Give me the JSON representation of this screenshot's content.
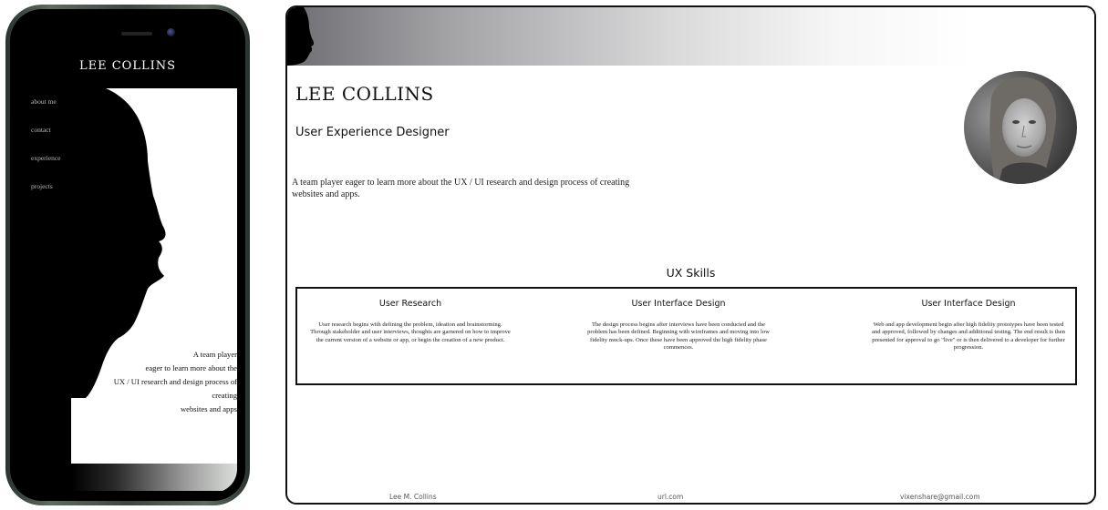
{
  "mobile": {
    "brand": "LEE COLLINS",
    "nav": [
      "about me",
      "contact",
      "experience",
      "projects"
    ],
    "tagline_lines": [
      "A team player",
      "eager to learn more about the",
      "UX / UI research and design process of",
      "creating",
      "websites and apps"
    ]
  },
  "desktop": {
    "name": "LEE COLLINS",
    "role": "User Experience Designer",
    "intro": "A team player eager to learn more about the UX / UI research and design process of creating websites and apps.",
    "skills_heading": "UX Skills",
    "skills": [
      {
        "title": "User Research",
        "body": "User research begins with defining the problem, ideation and brainstorming. Through stakeholder and user interviews, thoughts are garnered on how to improve the current version of a website or app, or begin the creation of a new product."
      },
      {
        "title": "User Interface Design",
        "body": "The design process begins after interviews have been conducted and the problem has been defined. Beginning with wireframes and moving into low fidelity mock-ups. Once these have been approved the high fidelity phase commences."
      },
      {
        "title": "User Interface Design",
        "body": "Web and app development begin after high fidelity prototypes have been tested and approved, followed by changes and additional testing. The end result is then presented for approval to go \"live\" or is then delivered to a developer for further progression."
      }
    ],
    "footer": {
      "name": "Lee M. Collins",
      "url": "url.com",
      "email": "vixenshare@gmail.com"
    }
  },
  "colors": {
    "phone_frame": "#3c4640",
    "header_gradient_start": "#6e6e72",
    "header_gradient_end": "#ffffff",
    "text": "#111111"
  },
  "icons": {
    "header_decoration": "face-silhouette",
    "phone_art": "face-silhouette"
  }
}
